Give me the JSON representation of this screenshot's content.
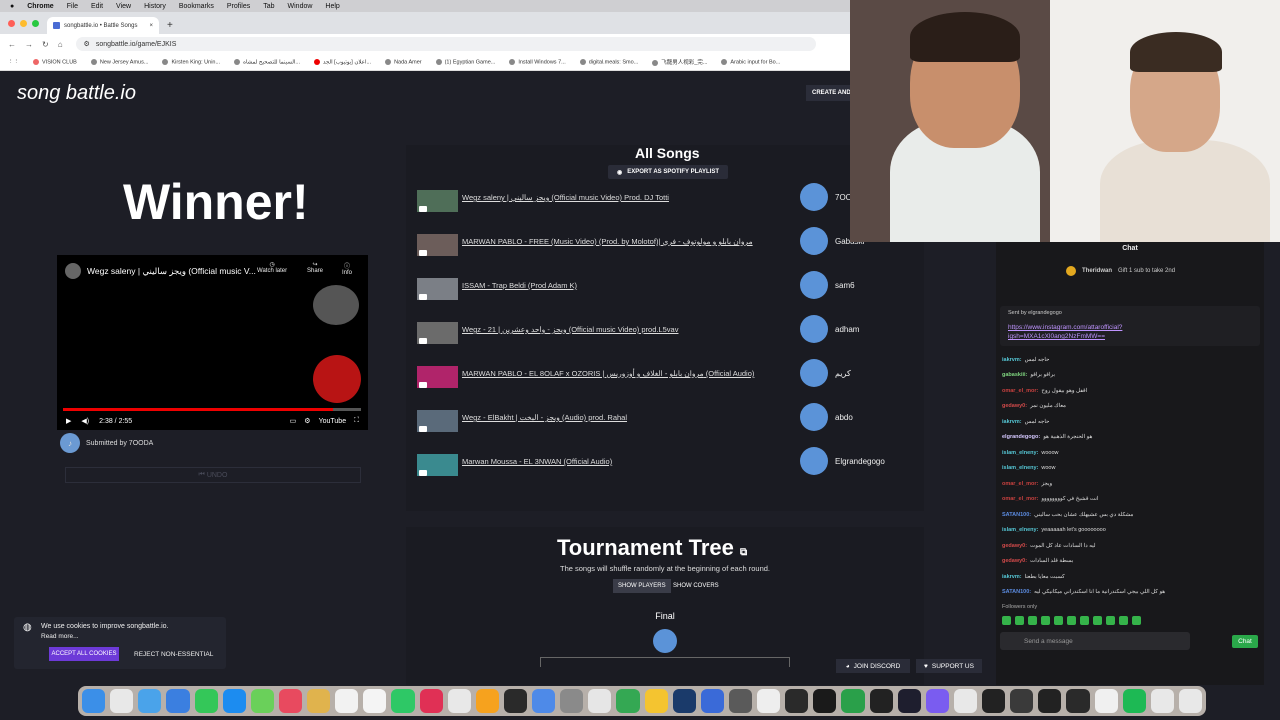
{
  "menubar": {
    "app": "Chrome",
    "items": [
      "File",
      "Edit",
      "View",
      "History",
      "Bookmarks",
      "Profiles",
      "Tab",
      "Window",
      "Help"
    ]
  },
  "tab": {
    "title": "songbattle.io • Battle Songs",
    "close": "×",
    "new": "+"
  },
  "address": {
    "url": "songbattle.io/game/EJKIS"
  },
  "bookmarks": [
    "VISION CLUB",
    "New Jersey Amus...",
    "Kirsten King: Unin...",
    "السينما للتصحيح لمشاه...",
    "اعلان [يوتيوب] الجد...",
    "Nada Amer",
    "(1) Egyptian Game...",
    "Install Windows 7...",
    "digital.meals: Smo...",
    "飞龍男人视彩_完...",
    "Arabic input for Bo..."
  ],
  "logo": {
    "text": "song battle.io"
  },
  "header": {
    "create": "CREATE AND"
  },
  "winner": {
    "heading": "Winner!"
  },
  "video": {
    "title": "Wegz saleny | ويجز ساليني (Official music V...",
    "watch_later": "Watch later",
    "share": "Share",
    "info": "Info",
    "time": "2:38 / 2:55",
    "progress": 0.905,
    "yt": "YouTube"
  },
  "submitted": {
    "text": "Submitted by 7OODA"
  },
  "undo": {
    "label": "UNDO"
  },
  "cookie": {
    "text": "We use cookies to improve songbattle.io.",
    "more": "Read more...",
    "accept": "ACCEPT ALL COOKIES",
    "reject": "REJECT NON-ESSENTIAL"
  },
  "all_songs": {
    "title": "All Songs",
    "export": "EXPORT AS SPOTIFY PLAYLIST",
    "songs": [
      {
        "title": "Wegz saleny | ويجز ساليني (Official music Video) Prod. DJ Totti",
        "user": "7OO"
      },
      {
        "title": "MARWAN PABLO - FREE (Music Video) (Prod. by Molotof)| مروان بابلو و مولوتوف - فري",
        "user": "Gabaski"
      },
      {
        "title": "ISSAM - Trap Beldi (Prod Adam K)",
        "user": "sam6"
      },
      {
        "title": "Wegz - 21 | ويجز - واحد وعشرين (Official music Video) prod.L5vav",
        "user": "adham"
      },
      {
        "title": "MARWAN PABLO - EL 8OLAF x OZORIS | مروان بابلو - الغلاف و أوزوريس (Official Audio)",
        "user": "كريم"
      },
      {
        "title": "Wegz - ElBakht | ويجز - البخت (Audio) prod. Rahal",
        "user": "abdo"
      },
      {
        "title": "Marwan Moussa - EL 3NWAN (Official Audio)",
        "user": "Elgrandegogo"
      }
    ]
  },
  "tree": {
    "title": "Tournament Tree",
    "sub": "The songs will shuffle randomly at the beginning of each round.",
    "show_players": "SHOW PLAYERS",
    "show_covers": "SHOW COVERS",
    "final": "Final"
  },
  "footer": {
    "discord": "JOIN DISCORD",
    "support": "SUPPORT US"
  },
  "chat": {
    "title": "Chat",
    "gift_user": "Theridwan",
    "gift_text": "Gift 1 sub to take 2nd",
    "pinned_by": "Sent by elgrandegogo",
    "pinned_link": "https://www.instagram.com/attarofficial?igsh=MXA1cXl0ang2NzFmMW==",
    "messages": [
      {
        "user": "iakrvm:",
        "text": "حاجه لمس",
        "color": "#56c8d6"
      },
      {
        "user": "gabaskiii:",
        "text": "براقو براقو",
        "color": "#7fd57f"
      },
      {
        "user": "omar_el_mor:",
        "text": "اقفل وهو بيقول روح",
        "color": "#c8413f"
      },
      {
        "user": "gedawy0:",
        "text": "معاك مليون نمر",
        "color": "#d24a4a"
      },
      {
        "user": "iakrvm:",
        "text": "حاجه لمس",
        "color": "#56c8d6"
      },
      {
        "user": "elgrandegogo:",
        "text": "هو الحنجرة الذهبية هو",
        "color": "#d5c8ff"
      },
      {
        "user": "islam_elneny:",
        "text": "wooow",
        "color": "#56c8d6"
      },
      {
        "user": "islam_elneny:",
        "text": "woow",
        "color": "#56c8d6"
      },
      {
        "user": "omar_el_mor:",
        "text": "ويجز",
        "color": "#c8413f"
      },
      {
        "user": "omar_el_mor:",
        "text": "انت قشيخ في كوووووووو",
        "color": "#c8413f"
      },
      {
        "user": "SATAN100:",
        "text": "مشكلة دي بس عشيهلك عشان بحب ساليني",
        "color": "#5b8be0"
      },
      {
        "user": "islam_elneny:",
        "text": "yeaaaaah let's goooooooo",
        "color": "#56c8d6"
      },
      {
        "user": "gedawy0:",
        "text": "ليه دا السادات عاد كل الموت",
        "color": "#d24a4a"
      },
      {
        "user": "gedawy0:",
        "text": "بسطة قلد السادات",
        "color": "#d24a4a"
      },
      {
        "user": "iakrvm:",
        "text": "كسبت معايا بطعنا",
        "color": "#56c8d6"
      },
      {
        "user": "SATAN100:",
        "text": "هو كل اللي بيجي اسكندرانية ما انا اسكندراني ميكانيكي ليه",
        "color": "#5b8be0"
      }
    ],
    "followers": "Followers only",
    "placeholder": "Send a message",
    "send": "Chat"
  },
  "colors": {
    "accent": "#6d3ad8",
    "chat_green": "#2aa84a",
    "bg": "#1d1e26"
  }
}
